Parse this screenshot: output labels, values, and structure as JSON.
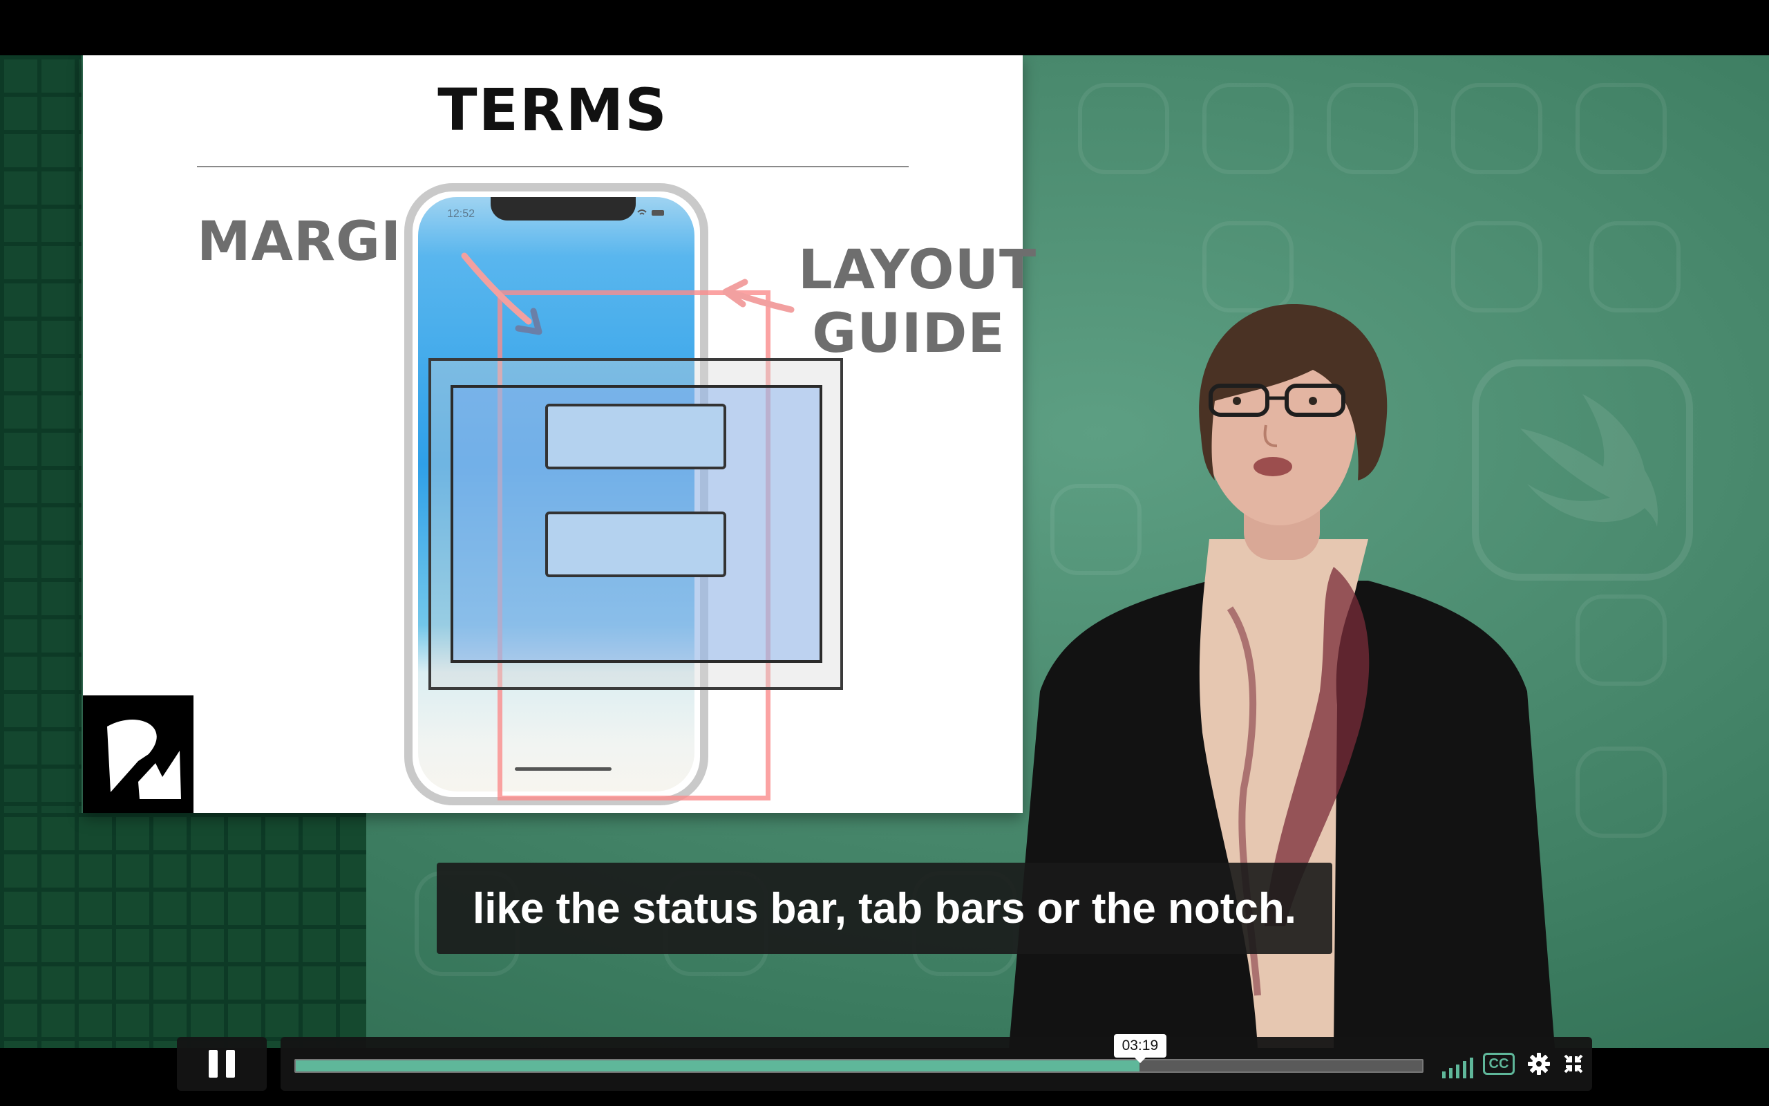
{
  "slide": {
    "title": "TERMS",
    "label_margin": "MARGIN",
    "label_layout_line1": "LAYOUT",
    "label_layout_line2": "GUIDE",
    "phone_time": "12:52"
  },
  "caption": {
    "text": "like the status bar, tab bars or the notch."
  },
  "player": {
    "state": "playing",
    "current_time": "03:19",
    "progress": 0.749,
    "captions_label": "CC",
    "accent_color": "#5fb79a"
  },
  "icons": {
    "pause": "pause-icon",
    "volume": "volume-icon",
    "captions": "closed-captions-icon",
    "settings": "gear-icon",
    "fullscreen": "exit-fullscreen-icon",
    "logo": "rw-logo-icon"
  }
}
